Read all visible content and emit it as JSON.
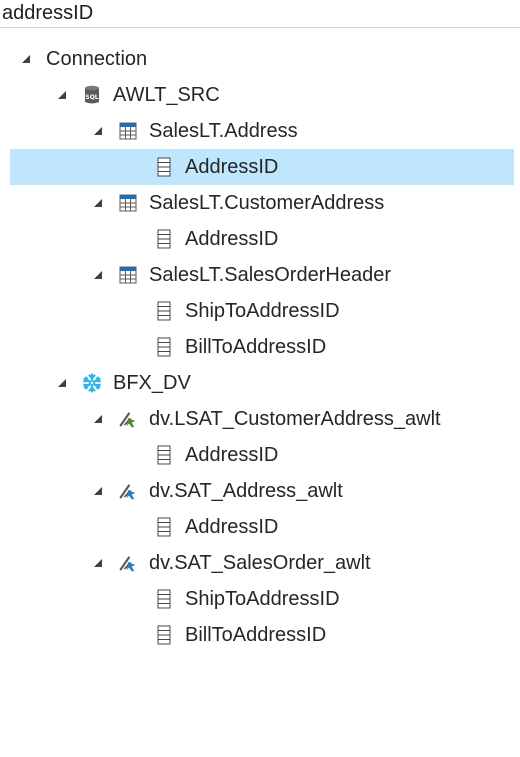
{
  "search": {
    "value": "addressID"
  },
  "tree": {
    "root_label": "Connection",
    "connections": [
      {
        "label": "AWLT_SRC",
        "icon": "sql-database-icon",
        "objects": [
          {
            "label": "SalesLT.Address",
            "icon": "table-icon",
            "columns": [
              "AddressID"
            ]
          },
          {
            "label": "SalesLT.CustomerAddress",
            "icon": "table-icon",
            "columns": [
              "AddressID"
            ]
          },
          {
            "label": "SalesLT.SalesOrderHeader",
            "icon": "table-icon",
            "columns": [
              "ShipToAddressID",
              "BillToAddressID"
            ]
          }
        ]
      },
      {
        "label": "BFX_DV",
        "icon": "snowflake-icon",
        "objects": [
          {
            "label": "dv.LSAT_CustomerAddress_awlt",
            "icon": "link-satellite-icon",
            "columns": [
              "AddressID"
            ]
          },
          {
            "label": "dv.SAT_Address_awlt",
            "icon": "satellite-icon",
            "columns": [
              "AddressID"
            ]
          },
          {
            "label": "dv.SAT_SalesOrder_awlt",
            "icon": "satellite-icon",
            "columns": [
              "ShipToAddressID",
              "BillToAddressID"
            ]
          }
        ]
      }
    ]
  },
  "colors": {
    "selection": "#bfe6fd",
    "table_icon": "#1f6fb5",
    "snowflake": "#29b5e8",
    "satellite_blue": "#1f7fc4",
    "satellite_green": "#4f8a2b"
  }
}
